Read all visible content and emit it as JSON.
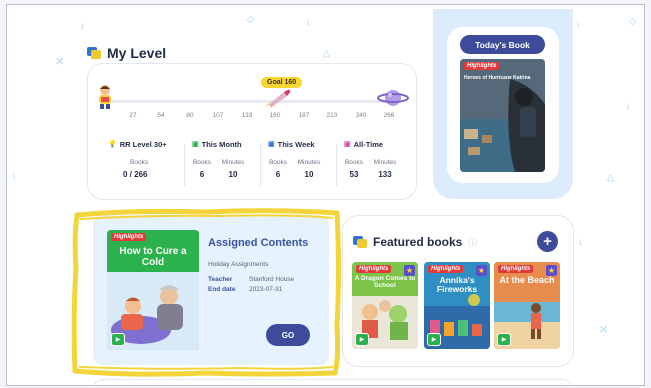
{
  "level": {
    "title": "My Level",
    "goal": "Goal 160",
    "ticks": [
      "27",
      "54",
      "80",
      "107",
      "133",
      "160",
      "187",
      "213",
      "240",
      "266"
    ],
    "stats": [
      {
        "label": "RR Level 30+",
        "icon": "lightbulb-icon",
        "sub_labels": [
          "Books"
        ],
        "values": [
          "0 / 266"
        ]
      },
      {
        "label": "This Month",
        "icon": "calendar-check-icon",
        "sub_labels": [
          "Books",
          "Minutes"
        ],
        "values": [
          "6",
          "10"
        ]
      },
      {
        "label": "This Week",
        "icon": "calendar-week-icon",
        "sub_labels": [
          "Books",
          "Minutes"
        ],
        "values": [
          "6",
          "10"
        ]
      },
      {
        "label": "All-Time",
        "icon": "calendar-all-icon",
        "sub_labels": [
          "Books",
          "Minutes"
        ],
        "values": [
          "53",
          "133"
        ]
      }
    ]
  },
  "today": {
    "button": "Today's Book",
    "cover_brand": "Highlights",
    "cover_title": "Heroes of Hurricane Katrina"
  },
  "assigned": {
    "title": "Assigned Contents",
    "subtitle": "Holiday Assignments",
    "teacher_label": "Teacher",
    "teacher": "Stanford House",
    "end_label": "End date",
    "end_date": "2023-07-31",
    "go": "GO",
    "cover_brand": "Highlights",
    "cover_title": "How to Cure a Cold"
  },
  "featured": {
    "title": "Featured books",
    "add": "+",
    "books": [
      {
        "brand": "Highlights",
        "title": "A Dragon Comes to School"
      },
      {
        "brand": "Highlights",
        "title": "Annika's Fireworks"
      },
      {
        "brand": "Highlights",
        "title": "At the Beach"
      }
    ]
  },
  "colors": {
    "navy": "#3d4b9a",
    "accent_blue": "#3a55a3",
    "light_blue": "#e6f2fd",
    "today_bg": "#dcecfd",
    "goal_yellow": "#f7d634",
    "highlight_marker": "#f3d43a",
    "highlights_red": "#e23a3a",
    "green": "#2bb24d"
  }
}
